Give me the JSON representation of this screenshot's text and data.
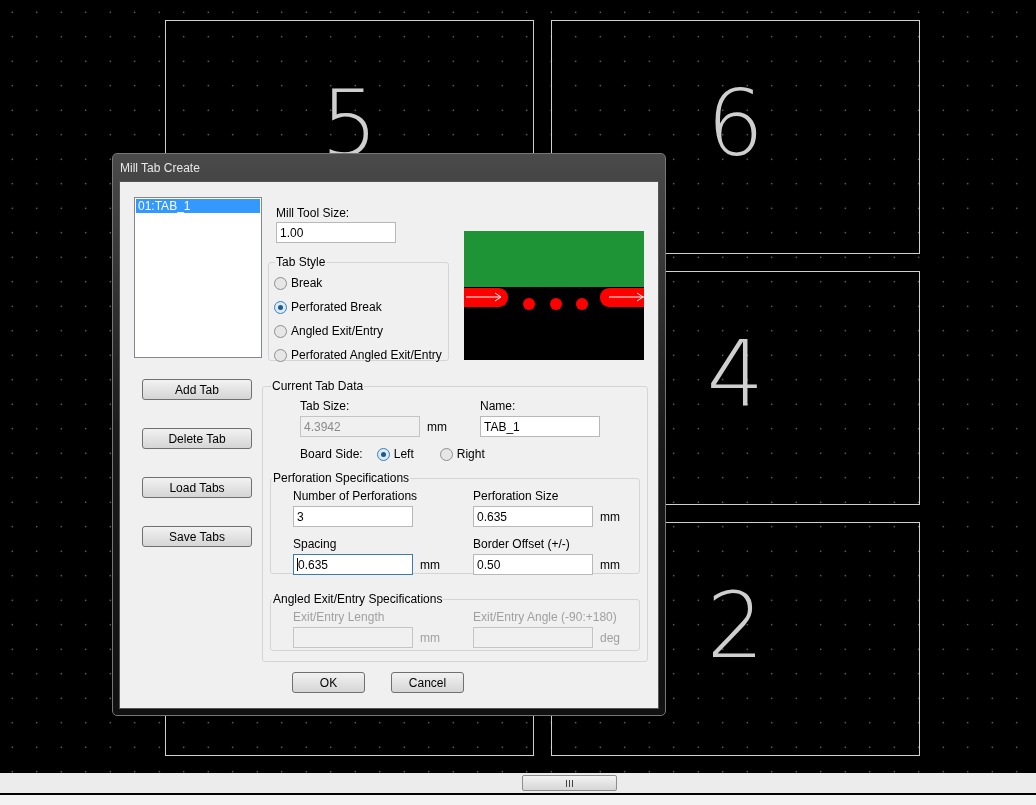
{
  "boards": [
    {
      "label": "5"
    },
    {
      "label": "6"
    },
    {
      "label": "4"
    },
    {
      "label": "2"
    }
  ],
  "window": {
    "title": "Mill Tab Create"
  },
  "tab_list": [
    {
      "label": "01:TAB_1",
      "selected": true
    }
  ],
  "side_buttons": [
    "Add Tab",
    "Delete Tab",
    "Load Tabs",
    "Save Tabs"
  ],
  "mill_tool_size": {
    "label": "Mill Tool Size:",
    "value": "1.00"
  },
  "tab_style": {
    "title": "Tab Style",
    "options": [
      {
        "label": "Break",
        "selected": false
      },
      {
        "label": "Perforated Break",
        "selected": true
      },
      {
        "label": "Angled Exit/Entry",
        "selected": false
      },
      {
        "label": "Perforated Angled Exit/Entry",
        "selected": false
      }
    ]
  },
  "current_tab_data": {
    "title": "Current Tab Data",
    "tab_size": {
      "label": "Tab Size:",
      "value": "4.3942",
      "unit": "mm",
      "disabled": true
    },
    "name": {
      "label": "Name:",
      "value": "TAB_1",
      "disabled": false
    },
    "board_side": {
      "label": "Board Side:",
      "options": [
        {
          "label": "Left",
          "selected": true
        },
        {
          "label": "Right",
          "selected": false
        }
      ]
    }
  },
  "perforation": {
    "title": "Perforation Specifications",
    "disabled": false,
    "fields": [
      {
        "label": "Number of Perforations",
        "value": "3",
        "focused": false
      },
      {
        "label": "Perforation Size",
        "value": "0.635",
        "unit": "mm",
        "focused": false
      },
      {
        "label": "Spacing",
        "value": "0.635",
        "unit": "mm",
        "focused": true
      },
      {
        "label": "Border Offset (+/-)",
        "value": "0.50",
        "unit": "mm",
        "focused": false
      }
    ]
  },
  "angled": {
    "title": "Angled Exit/Entry Specifications",
    "disabled": true,
    "fields": [
      {
        "label": "Exit/Entry Length",
        "unit": "mm",
        "focused": false
      },
      {
        "label": "Exit/Entry Angle (-90:+180)",
        "unit": "deg",
        "focused": false
      }
    ]
  },
  "footer_buttons": [
    "OK",
    "Cancel"
  ]
}
